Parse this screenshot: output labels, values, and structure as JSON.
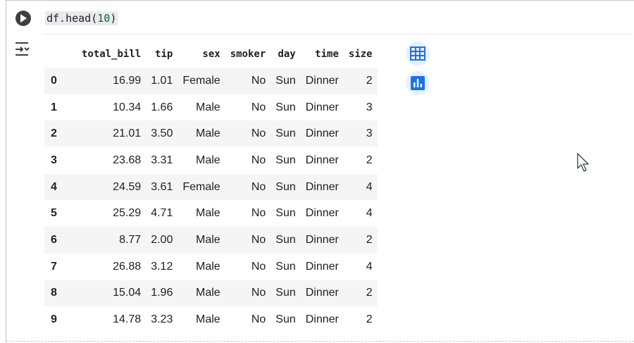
{
  "code_cell": {
    "code_prefix": "df.head(",
    "code_arg": "10",
    "code_suffix": ")",
    "run_icon": "play-circle-icon"
  },
  "output": {
    "toggle_icon": "output-toggle-icon",
    "table": {
      "columns": [
        "",
        "total_bill",
        "tip",
        "sex",
        "smoker",
        "day",
        "time",
        "size"
      ],
      "rows": [
        [
          "0",
          "16.99",
          "1.01",
          "Female",
          "No",
          "Sun",
          "Dinner",
          "2"
        ],
        [
          "1",
          "10.34",
          "1.66",
          "Male",
          "No",
          "Sun",
          "Dinner",
          "3"
        ],
        [
          "2",
          "21.01",
          "3.50",
          "Male",
          "No",
          "Sun",
          "Dinner",
          "3"
        ],
        [
          "3",
          "23.68",
          "3.31",
          "Male",
          "No",
          "Sun",
          "Dinner",
          "2"
        ],
        [
          "4",
          "24.59",
          "3.61",
          "Female",
          "No",
          "Sun",
          "Dinner",
          "4"
        ],
        [
          "5",
          "25.29",
          "4.71",
          "Male",
          "No",
          "Sun",
          "Dinner",
          "4"
        ],
        [
          "6",
          "8.77",
          "2.00",
          "Male",
          "No",
          "Sun",
          "Dinner",
          "2"
        ],
        [
          "7",
          "26.88",
          "3.12",
          "Male",
          "No",
          "Sun",
          "Dinner",
          "4"
        ],
        [
          "8",
          "15.04",
          "1.96",
          "Male",
          "No",
          "Sun",
          "Dinner",
          "2"
        ],
        [
          "9",
          "14.78",
          "3.23",
          "Male",
          "No",
          "Sun",
          "Dinner",
          "2"
        ]
      ]
    },
    "side_buttons": [
      {
        "icon": "table-view-icon"
      },
      {
        "icon": "bar-chart-icon"
      }
    ]
  },
  "colors": {
    "accent": "#1a73e8",
    "row_stripe": "#f5f5f5",
    "run_button": "#3c4043"
  }
}
